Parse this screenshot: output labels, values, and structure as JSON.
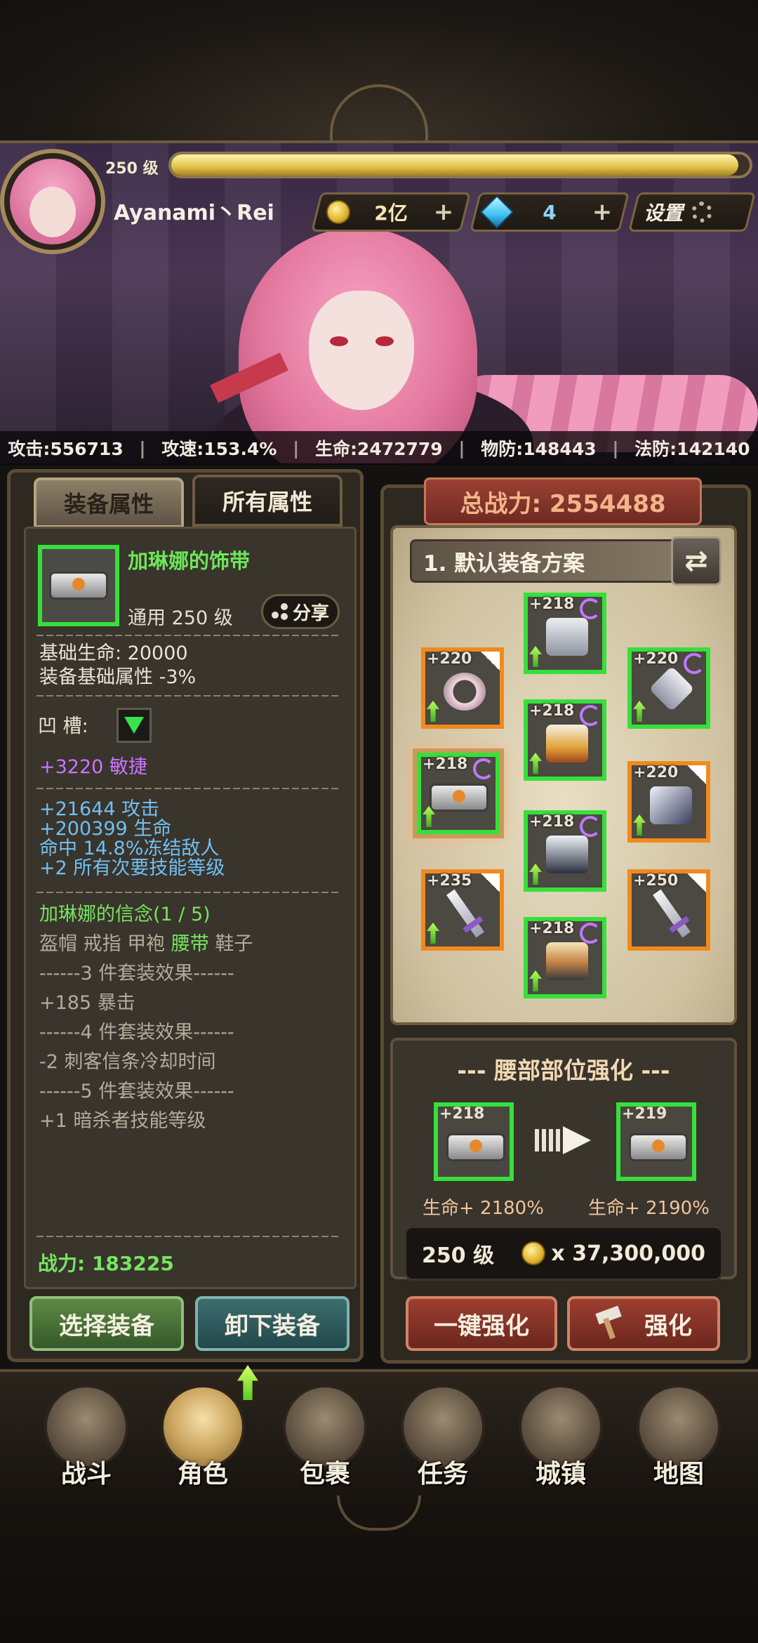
{
  "player": {
    "level": "250 级",
    "xp_fraction": 0.98,
    "name": "Ayanami丶Rei"
  },
  "resources": {
    "gold": "2亿",
    "gems": "4",
    "settings_label": "设置"
  },
  "stats": [
    {
      "text": "攻击:556713"
    },
    {
      "text": "攻速:153.4%"
    },
    {
      "text": "生命:2472779"
    },
    {
      "text": "物防:148443"
    },
    {
      "text": "法防:142140"
    }
  ],
  "tabs": {
    "equip_attrs": "装备属性",
    "all_attrs": "所有属性"
  },
  "item": {
    "name": "加琳娜的饰带",
    "type_level": "通用  250 级",
    "share_label": "分享",
    "base_life": "基础生命:  20000",
    "base_attr": "装备基础属性 -3%",
    "socket_label": "凹    槽:",
    "socket_bonus": "+3220 敏捷",
    "bonus_1": "+21644 攻击",
    "bonus_2": "+200399 生命",
    "bonus_3": "命中 14.8%冻结敌人",
    "bonus_4": "+2 所有次要技能等级",
    "set_name": "加琳娜的信念(1 / 5)",
    "set_pieces": [
      {
        "label": "盔帽",
        "active": false
      },
      {
        "label": "戒指",
        "active": false
      },
      {
        "label": "甲袍",
        "active": false
      },
      {
        "label": "腰带",
        "active": true
      },
      {
        "label": "鞋子",
        "active": false
      }
    ],
    "set_3_header": "------3 件套装效果------",
    "set_3_effect": "+185 暴击",
    "set_4_header": "------4 件套装效果------",
    "set_4_effect": "-2 刺客信条冷却时间",
    "set_5_header": "------5 件套装效果------",
    "set_5_effect": "+1 暗杀者技能等级",
    "power": "战力:  183225"
  },
  "left_buttons": {
    "select": "选择装备",
    "unequip": "卸下装备"
  },
  "loadout": {
    "total_power": "总战力:  2554488",
    "plan_name": "1. 默认装备方案",
    "slots": [
      {
        "id": "helmet",
        "level": "+218",
        "rarity": "green",
        "mark": "swirl"
      },
      {
        "id": "ring",
        "level": "+220",
        "rarity": "orange",
        "mark": "flag"
      },
      {
        "id": "amulet",
        "level": "+220",
        "rarity": "green",
        "mark": "swirl"
      },
      {
        "id": "armor",
        "level": "+218",
        "rarity": "green",
        "mark": "swirl"
      },
      {
        "id": "belt",
        "level": "+218",
        "rarity": "green",
        "mark": "swirl"
      },
      {
        "id": "gloves",
        "level": "+220",
        "rarity": "orange",
        "mark": "flag"
      },
      {
        "id": "pants",
        "level": "+218",
        "rarity": "green",
        "mark": "swirl"
      },
      {
        "id": "weapon-left",
        "level": "+235",
        "rarity": "orange",
        "mark": "flag"
      },
      {
        "id": "weapon-right",
        "level": "+250",
        "rarity": "orange",
        "mark": "flag"
      },
      {
        "id": "boots",
        "level": "+218",
        "rarity": "green",
        "mark": "swirl"
      }
    ]
  },
  "enhance": {
    "title": "--- 腰部部位强化 ---",
    "from_level": "+218",
    "to_level": "+219",
    "from_stat": "生命+ 2180%",
    "to_stat": "生命+ 2190%",
    "cost_level": "250 级",
    "cost": "x 37,300,000",
    "auto_label": "一键强化",
    "enhance_label": "强化"
  },
  "nav": [
    {
      "label": "战斗",
      "icon": "battle-icon"
    },
    {
      "label": "角色",
      "icon": "character-icon"
    },
    {
      "label": "包裹",
      "icon": "bag-icon"
    },
    {
      "label": "任务",
      "icon": "quest-scroll-icon"
    },
    {
      "label": "城镇",
      "icon": "town-tower-icon"
    },
    {
      "label": "地图",
      "icon": "map-icon"
    }
  ],
  "colors": {
    "rarity_green": "#36e03a",
    "rarity_orange": "#f08a1e",
    "item_name": "#6ce65a",
    "socket_purple": "#c975ff",
    "bonus_blue": "#6fc0f4"
  }
}
